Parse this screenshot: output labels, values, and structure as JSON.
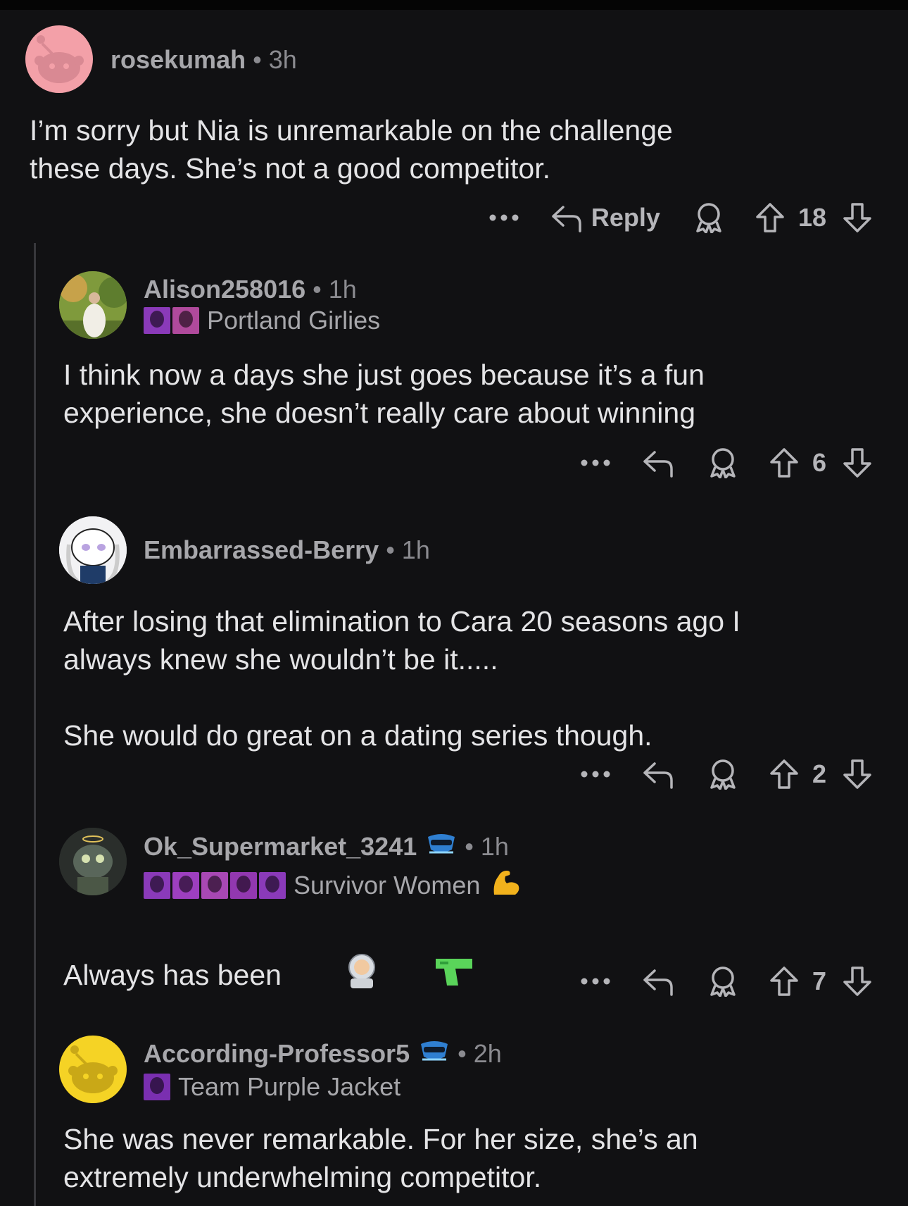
{
  "comments": [
    {
      "username": "rosekumah",
      "time": "3h",
      "body": "I’m sorry but Nia is unremarkable on the challenge\nthese days. She’s not a good competitor.",
      "reply_label": "Reply",
      "votes": "18",
      "avatar_color": "#f3a0a8"
    },
    {
      "username": "Alison258016",
      "time": "1h",
      "flair": "Portland Girlies",
      "body": "I think now a days she just goes because it’s a fun\nexperience, she doesn’t really care about winning",
      "votes": "6"
    },
    {
      "username": "Embarrassed-Berry",
      "time": "1h",
      "body": "After losing that elimination to Cara 20 seasons ago I\nalways knew she wouldn’t be it.....\n\nShe would do great on a dating series though.",
      "votes": "2"
    },
    {
      "username": "Ok_Supermarket_3241",
      "time": "1h",
      "flair": "Survivor Women",
      "body": "Always has been",
      "votes": "7"
    },
    {
      "username": "According-Professor5",
      "time": "2h",
      "flair": "Team Purple Jacket",
      "body": "She was never remarkable. For her size, she’s an\nextremely underwhelming competitor.",
      "avatar_color": "#f5d325"
    }
  ],
  "separator": "•",
  "icons": {
    "more": "more-icon",
    "reply": "reply-arrow-icon",
    "award": "award-icon",
    "upvote": "upvote-arrow-icon",
    "downvote": "downvote-arrow-icon",
    "snoo_badge": "snoovatar-badge-icon",
    "flex": "flexed-biceps-emoji",
    "astronaut": "astronaut-emoji",
    "water_pistol": "water-pistol-emoji"
  },
  "colors": {
    "background": "#111113",
    "text": "#e4e4e6",
    "muted": "#a7a7ab",
    "thread_line": "#38383c",
    "flair_purple": "#8a3ab9"
  }
}
